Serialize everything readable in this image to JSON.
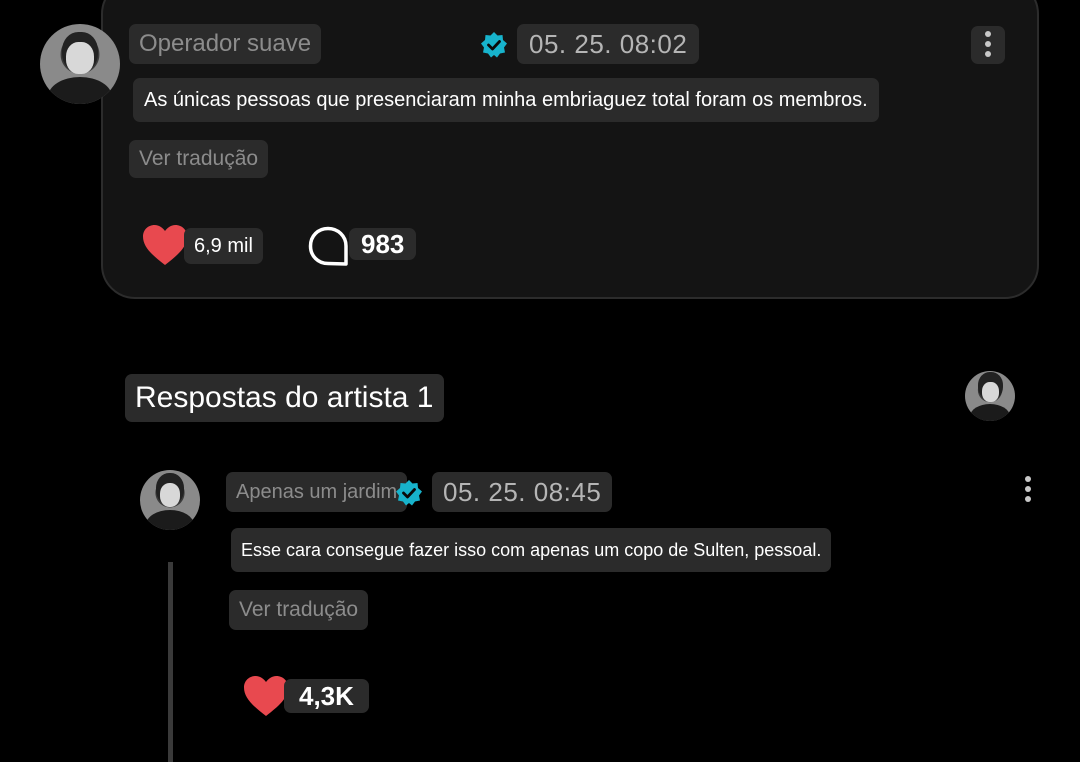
{
  "post": {
    "username": "Operador suave",
    "timestamp": "05. 25. 08:02",
    "text": "As únicas pessoas que presenciaram minha embriaguez total foram os membros.",
    "translate_label": "Ver tradução",
    "likes": "6,9 mil",
    "comments": "983"
  },
  "replies_section": {
    "heading": "Respostas do artista 1"
  },
  "reply": {
    "username": "Apenas um jardim",
    "timestamp": "05. 25. 08:45",
    "text": "Esse cara consegue fazer isso com apenas um copo de Sulten, pessoal.",
    "translate_label": "Ver tradução",
    "likes": "4,3K"
  },
  "colors": {
    "background": "#000000",
    "card": "#141414",
    "pill": "#2b2b2b",
    "heart": "#e8494f",
    "verified": "#17b3cc"
  },
  "icons": [
    "verified-badge-icon",
    "kebab-menu-icon",
    "heart-icon",
    "comment-bubble-icon"
  ]
}
